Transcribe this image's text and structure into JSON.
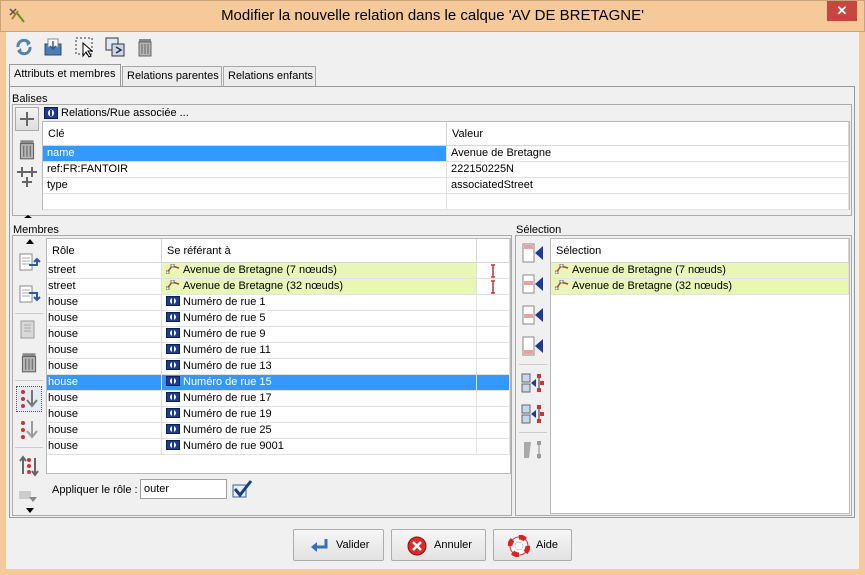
{
  "window": {
    "title": "Modifier la nouvelle relation dans le calque 'AV DE BRETAGNE'",
    "close_label": "✕"
  },
  "toolbar": {
    "icons": [
      "refresh-icon",
      "apply-icon",
      "select-icon",
      "duplicate-icon",
      "delete-icon"
    ]
  },
  "tabs": [
    {
      "label": "Attributs et membres",
      "active": true
    },
    {
      "label": "Relations parentes",
      "active": false
    },
    {
      "label": "Relations enfants",
      "active": false
    }
  ],
  "tags": {
    "section_label": "Balises",
    "preset_label": "Relations/Rue associée ...",
    "columns": {
      "key": "Clé",
      "value": "Valeur"
    },
    "rows": [
      {
        "key": "name",
        "value": "Avenue de Bretagne"
      },
      {
        "key": "ref:FR:FANTOIR",
        "value": "222150225N"
      },
      {
        "key": "type",
        "value": "associatedStreet"
      },
      {
        "key": "",
        "value": ""
      }
    ]
  },
  "members": {
    "section_label": "Membres",
    "columns": {
      "role": "Rôle",
      "refers": "Se référant à"
    },
    "rows": [
      {
        "role": "street",
        "refers": "Avenue de Bretagne (7 nœuds)",
        "kind": "way",
        "linked": true
      },
      {
        "role": "street",
        "refers": "Avenue de Bretagne (32 nœuds)",
        "kind": "way",
        "linked": true
      },
      {
        "role": "house",
        "refers": "Numéro de rue 1",
        "kind": "relation",
        "linked": false
      },
      {
        "role": "house",
        "refers": "Numéro de rue 5",
        "kind": "relation",
        "linked": false
      },
      {
        "role": "house",
        "refers": "Numéro de rue 9",
        "kind": "relation",
        "linked": false
      },
      {
        "role": "house",
        "refers": "Numéro de rue 11",
        "kind": "relation",
        "linked": false
      },
      {
        "role": "house",
        "refers": "Numéro de rue 13",
        "kind": "relation",
        "linked": false
      },
      {
        "role": "house",
        "refers": "Numéro de rue 15",
        "kind": "relation",
        "linked": false
      },
      {
        "role": "house",
        "refers": "Numéro de rue 17",
        "kind": "relation",
        "linked": false
      },
      {
        "role": "house",
        "refers": "Numéro de rue 19",
        "kind": "relation",
        "linked": false
      },
      {
        "role": "house",
        "refers": "Numéro de rue 25",
        "kind": "relation",
        "linked": false
      },
      {
        "role": "house",
        "refers": "Numéro de rue 9001",
        "kind": "relation",
        "linked": false
      }
    ],
    "selected_index": 7,
    "apply_role_label": "Appliquer le rôle :",
    "apply_role_value": "outer"
  },
  "selection": {
    "section_label": "Sélection",
    "column": "Sélection",
    "rows": [
      {
        "label": "Avenue de Bretagne (7 nœuds)"
      },
      {
        "label": "Avenue de Bretagne (32 nœuds)"
      }
    ]
  },
  "buttons": {
    "ok": "Valider",
    "cancel": "Annuler",
    "help": "Aide"
  },
  "colors": {
    "titlebar": "#f5c99a",
    "selection_blue": "#3399ff",
    "highlight_green": "#e9f6b5",
    "relation_icon": "#1f3b8f"
  }
}
